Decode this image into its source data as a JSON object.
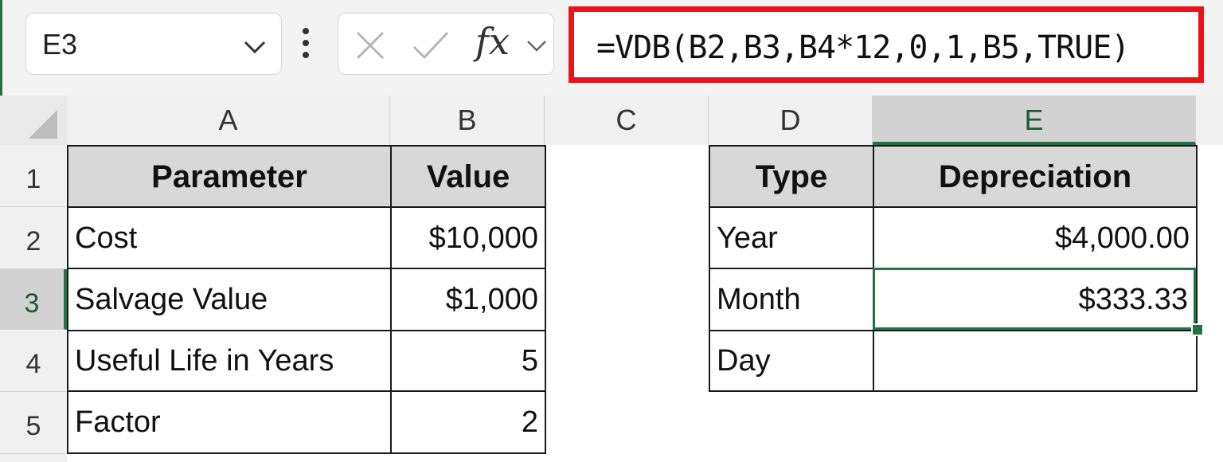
{
  "namebox": {
    "value": "E3"
  },
  "formula_bar": {
    "fx_label": "fx",
    "formula": "=VDB(B2,B3,B4*12,0,1,B5,TRUE)"
  },
  "columns": [
    "A",
    "B",
    "C",
    "D",
    "E"
  ],
  "rows": [
    "1",
    "2",
    "3",
    "4",
    "5"
  ],
  "left_table": {
    "headers": [
      "Parameter",
      "Value"
    ],
    "rows": [
      [
        "Cost",
        "$10,000"
      ],
      [
        "Salvage Value",
        "$1,000"
      ],
      [
        "Useful Life in Years",
        "5"
      ],
      [
        "Factor",
        "2"
      ]
    ]
  },
  "right_table": {
    "headers": [
      "Type",
      "Depreciation"
    ],
    "rows": [
      [
        "Year",
        "$4,000.00"
      ],
      [
        "Month",
        "$333.33"
      ],
      [
        "Day",
        ""
      ]
    ]
  },
  "selection": {
    "cell": "E3",
    "column": "E",
    "row": "3"
  },
  "colors": {
    "accent": "#217346",
    "highlight_border": "#e8141b",
    "header_fill": "#d8d8d8"
  }
}
